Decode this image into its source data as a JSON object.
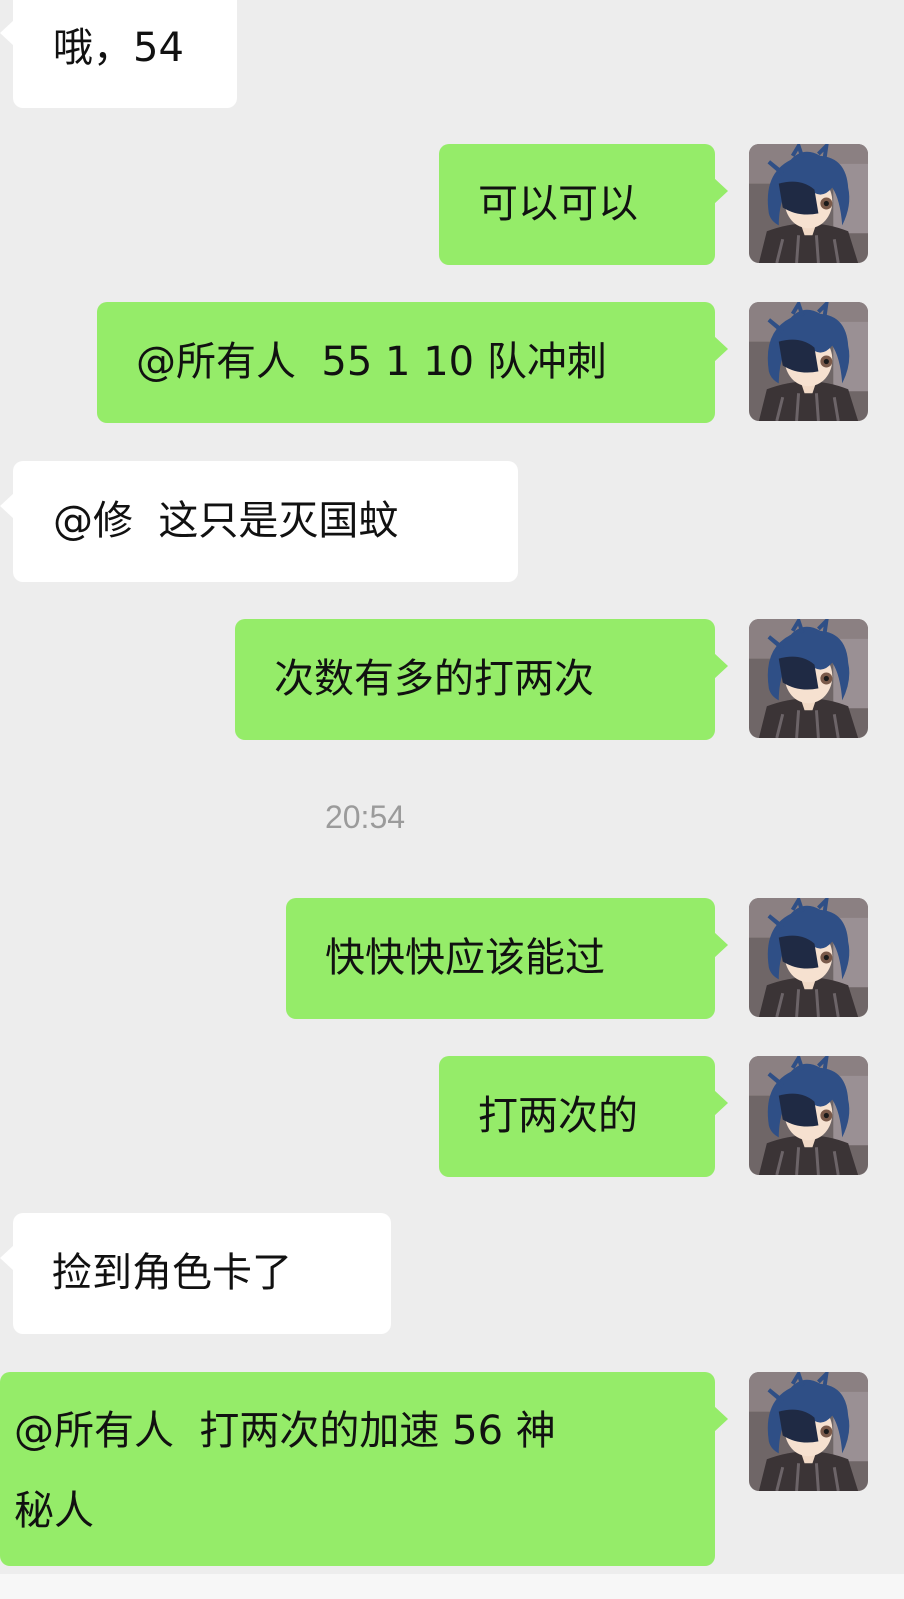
{
  "chat": {
    "timestamp": "20:54",
    "messages": [
      {
        "side": "in",
        "text": "哦，54"
      },
      {
        "side": "out",
        "text": "可以可以"
      },
      {
        "side": "out",
        "text": "@所有人  55 1 10 队冲刺"
      },
      {
        "side": "in",
        "text": "@修  这只是灭国蚊"
      },
      {
        "side": "out",
        "text": "次数有多的打两次"
      },
      {
        "side": "out",
        "text": "快快快应该能过"
      },
      {
        "side": "out",
        "text": "打两次的"
      },
      {
        "side": "in",
        "text": "捡到角色卡了"
      },
      {
        "side": "out",
        "text": "@所有人  打两次的加速 56 神\n秘人"
      }
    ]
  },
  "colors": {
    "background": "#ededed",
    "incoming_bubble": "#ffffff",
    "outgoing_bubble": "#95ec69",
    "timestamp_text": "#9b9b9b"
  },
  "icons": {
    "avatar": "anime-avatar-eyepatch"
  }
}
